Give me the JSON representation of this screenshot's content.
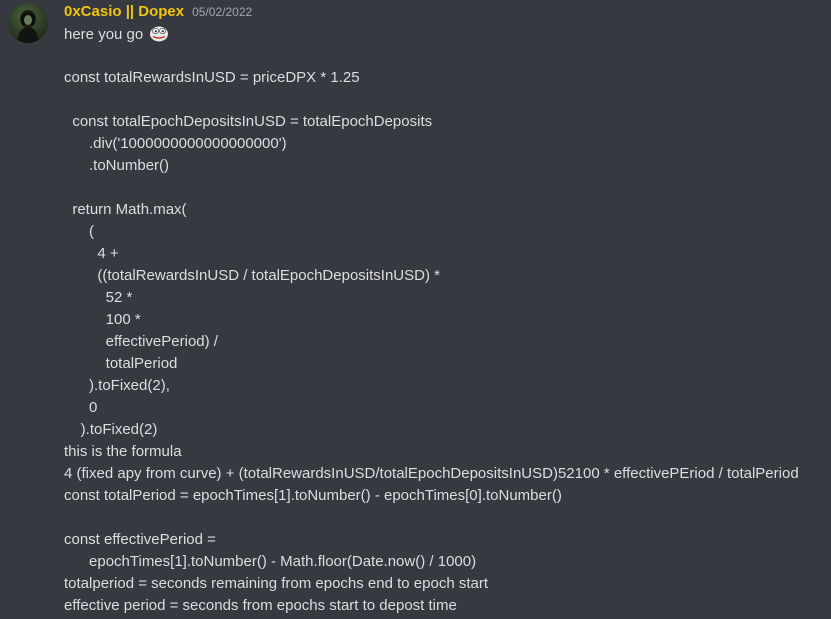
{
  "message": {
    "author": "0xCasio || Dopex",
    "timestamp": "05/02/2022",
    "author_color": "#f1c40f",
    "avatar_icon": "avatar-icon",
    "emoji_icon": "pepe-emoji-icon",
    "lines": [
      "here you go",
      "const totalRewardsInUSD = priceDPX * 1.25",
      "  const totalEpochDepositsInUSD = totalEpochDeposits",
      "      .div('1000000000000000000')",
      "      .toNumber()",
      "  return Math.max(",
      "      (",
      "        4 +",
      "        ((totalRewardsInUSD / totalEpochDepositsInUSD) *",
      "          52 *",
      "          100 *",
      "          effectivePeriod) /",
      "          totalPeriod",
      "      ).toFixed(2),",
      "      0",
      "    ).toFixed(2)",
      "this is the formula",
      "4 (fixed apy from curve) + (totalRewardsInUSD/totalEpochDepositsInUSD)52100 * effectivePEriod / totalPeriod",
      "const totalPeriod = epochTimes[1].toNumber() - epochTimes[0].toNumber()",
      "const effectivePeriod =",
      "      epochTimes[1].toNumber() - Math.floor(Date.now() / 1000)",
      "totalperiod = seconds remaining from epochs end to epoch start",
      "effective period = seconds from epochs start to depost time"
    ]
  }
}
